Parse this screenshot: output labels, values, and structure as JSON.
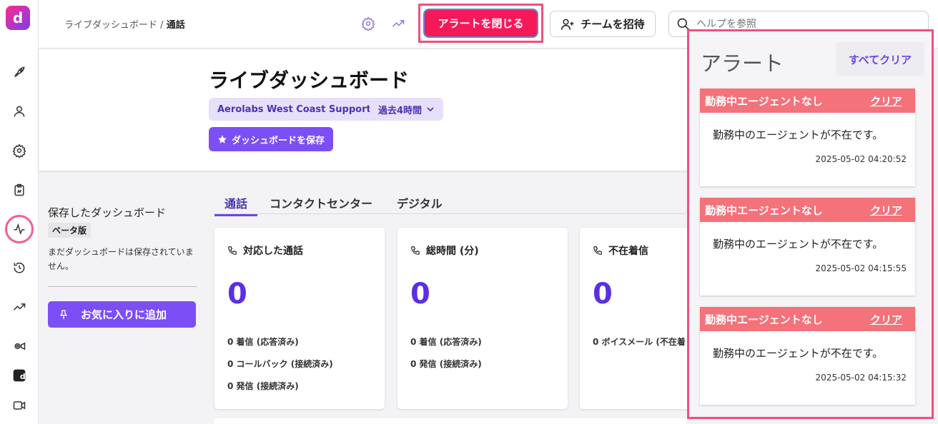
{
  "rail": {
    "logo": "d",
    "items": [
      "rocket-icon",
      "user-icon",
      "gear-icon",
      "clipboard-icon",
      "activity-icon",
      "history-icon",
      "trending-icon",
      "camera-gear-icon",
      "brand-icon",
      "video-icon"
    ]
  },
  "header": {
    "breadcrumb_root": "ライブダッシュボード",
    "breadcrumb_sep": "/",
    "breadcrumb_current": "通話",
    "dismiss_label": "アラートを閉じる",
    "invite_label": "チームを招待",
    "help_placeholder": "ヘルプを参照"
  },
  "title": {
    "heading": "ライブダッシュボード",
    "team_chip": "Aerolabs West Coast Support",
    "range_chip": "過去4時間",
    "save_label": "ダッシュボードを保存"
  },
  "saved": {
    "label": "保存したダッシュボード",
    "beta": "ベータ版",
    "empty": "まだダッシュボードは保存されていません。",
    "favorite_label": "お気に入りに追加"
  },
  "tabs": [
    {
      "label": "通話",
      "active": true
    },
    {
      "label": "コンタクトセンター",
      "active": false
    },
    {
      "label": "デジタル",
      "active": false
    }
  ],
  "cards": [
    {
      "title": "対応した通話",
      "value": "0",
      "lines": [
        "0 着信 (応答済み)",
        "0 コールバック (接続済み)",
        "0 発信 (接続済み)"
      ]
    },
    {
      "title": "総時間 (分)",
      "value": "0",
      "lines": [
        "0 着信 (応答済み)",
        "0 発信 (接続済み)"
      ]
    },
    {
      "title": "不在着信",
      "value": "0",
      "lines": [
        "0 ボイスメール (不在着"
      ]
    }
  ],
  "alerts": {
    "title": "アラート",
    "clear_all": "すべてクリア",
    "items": [
      {
        "title": "勤務中エージェントなし",
        "clear": "クリア",
        "message": "勤務中のエージェントが不在です。",
        "timestamp": "2025-05-02 04:20:52"
      },
      {
        "title": "勤務中エージェントなし",
        "clear": "クリア",
        "message": "勤務中のエージェントが不在です。",
        "timestamp": "2025-05-02 04:15:55"
      },
      {
        "title": "勤務中エージェントなし",
        "clear": "クリア",
        "message": "勤務中のエージェントが不在です。",
        "timestamp": "2025-05-02 04:15:32"
      }
    ]
  },
  "colors": {
    "accent": "#7b4ff5",
    "dismiss": "#f5195a",
    "alert_header": "#f4727a",
    "highlight": "#f0507f"
  }
}
